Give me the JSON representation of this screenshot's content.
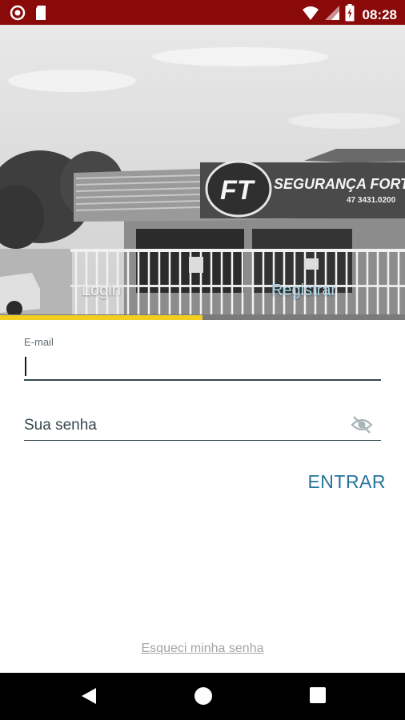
{
  "status_bar": {
    "time": "08:28"
  },
  "header": {
    "sign_brand": "SEGURANÇA FORTE",
    "sign_logo": "FT",
    "sign_phone": "47 3431.0200"
  },
  "tabs": [
    {
      "label": "Login",
      "selected": true
    },
    {
      "label": "Registrar",
      "selected": false
    }
  ],
  "form": {
    "email_label": "E-mail",
    "email_value": "",
    "password_placeholder": "Sua senha",
    "submit_label": "ENTRAR",
    "forgot_label": "Esqueci minha senha"
  },
  "colors": {
    "status_bar": "#8a0a0a",
    "tab_indicator": "#f2cf1e",
    "accent": "#27749c"
  },
  "icons": [
    "record-icon",
    "sd-card-icon",
    "wifi-icon",
    "signal-icon",
    "battery-icon",
    "eye-off-icon",
    "back-icon",
    "home-icon",
    "recents-icon"
  ]
}
